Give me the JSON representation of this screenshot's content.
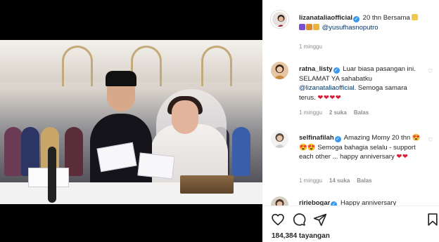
{
  "post": {
    "author": "lizanataliaofficial",
    "caption": "20 thn Bersama",
    "mention": "@yusufhasnoputro",
    "time": "1 minggu",
    "views": "184,384 tayangan"
  },
  "comments": [
    {
      "user": "ratna_listy",
      "text_before": "Luar biasa pasangan ini. SELAMAT YA sahabatku",
      "mention": "@lizanataliaofficial",
      "text_after": ". Semoga samara terus.",
      "emoji": "❤❤❤❤",
      "time": "1 minggu",
      "likes": "2 suka",
      "reply": "Balas"
    },
    {
      "user": "selfinafilah",
      "text_before": "Amazing Momy 20 thn",
      "emoji_mid": "😍😍😍",
      "text_after": "Semoga bahagia selalu - support each other ... happy anniversary",
      "emoji": "❤❤",
      "time": "1 minggu",
      "likes": "14 suka",
      "reply": "Balas"
    },
    {
      "user": "ririebogar",
      "text_before": "Happy anniversary"
    }
  ],
  "icons": {
    "like": "heart-icon",
    "comment": "comment-icon",
    "share": "paper-plane-icon",
    "save": "bookmark-icon",
    "verified": "verified-badge-icon"
  },
  "colors": {
    "verified": "#3897f0",
    "mention": "#00376b",
    "heart": "#d8203a",
    "meta": "#8e8e8e"
  }
}
